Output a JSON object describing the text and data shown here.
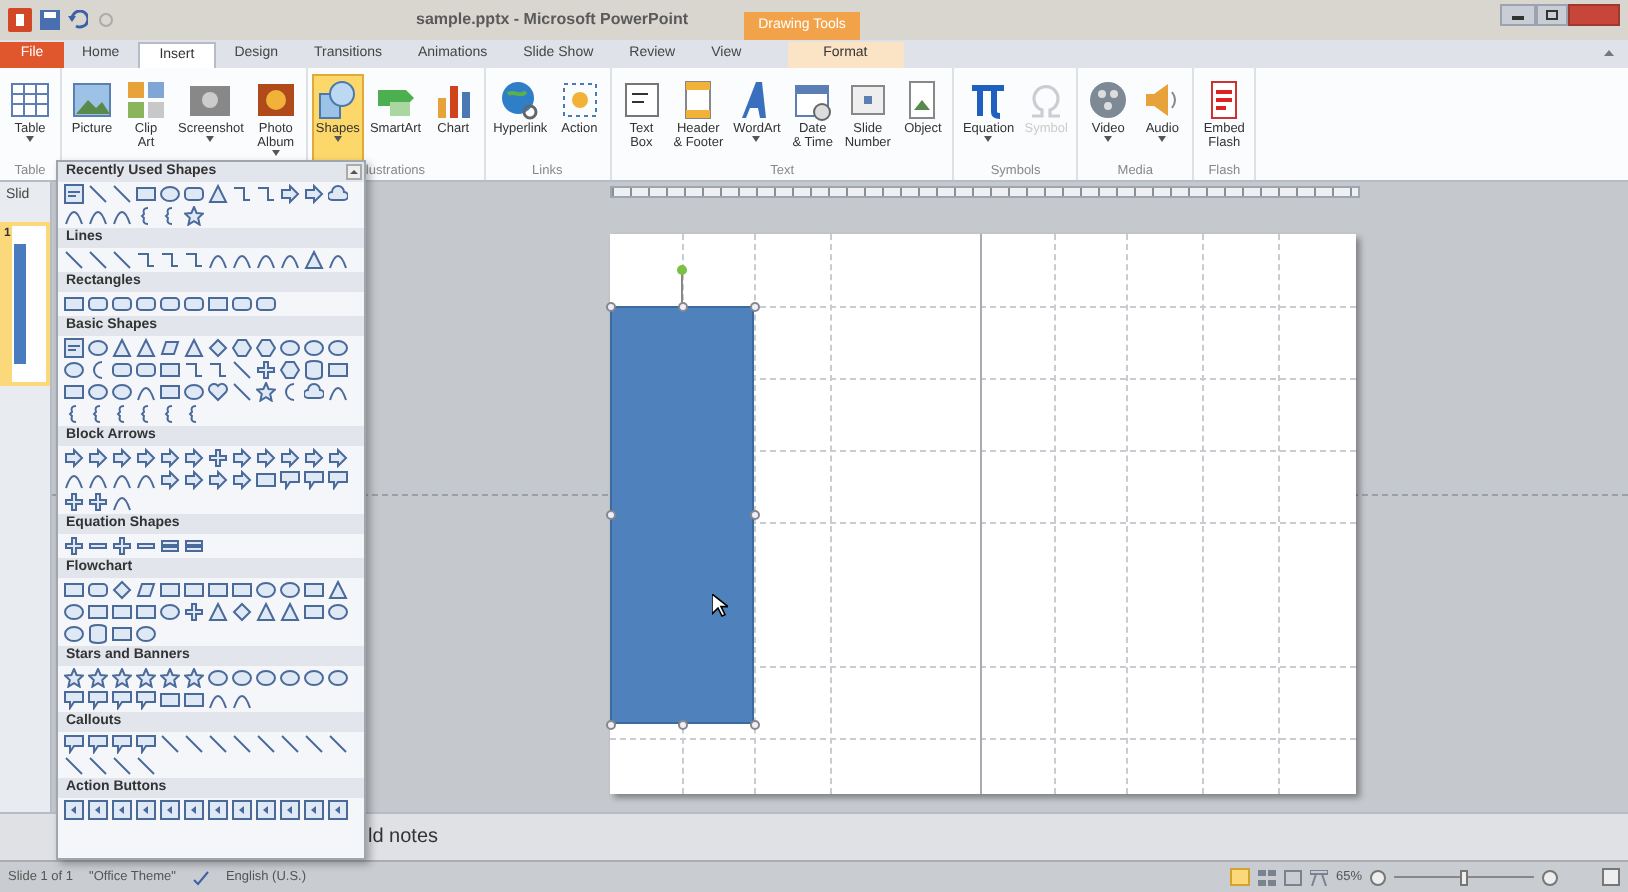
{
  "window": {
    "title": "sample.pptx - Microsoft PowerPoint",
    "context_tab": "Drawing Tools"
  },
  "tabs": [
    {
      "label": "File",
      "kind": "file",
      "selected": false
    },
    {
      "label": "Home",
      "kind": "tab",
      "selected": false
    },
    {
      "label": "Insert",
      "kind": "tab",
      "selected": true
    },
    {
      "label": "Design",
      "kind": "tab",
      "selected": false
    },
    {
      "label": "Transitions",
      "kind": "tab",
      "selected": false
    },
    {
      "label": "Animations",
      "kind": "tab",
      "selected": false
    },
    {
      "label": "Slide Show",
      "kind": "tab",
      "selected": false
    },
    {
      "label": "Review",
      "kind": "tab",
      "selected": false
    },
    {
      "label": "View",
      "kind": "tab",
      "selected": false
    },
    {
      "label": "Format",
      "kind": "context",
      "selected": false
    }
  ],
  "ribbon": [
    {
      "label": "Table",
      "buttons": [
        {
          "lines": [
            "Table"
          ],
          "dropdown": true,
          "selected": false,
          "disabled": false
        }
      ]
    },
    {
      "buttons": [
        {
          "lines": [
            "Picture"
          ],
          "dropdown": false,
          "selected": false,
          "disabled": false
        },
        {
          "lines": [
            "Clip",
            "Art"
          ],
          "dropdown": false,
          "selected": false,
          "disabled": false
        },
        {
          "lines": [
            "Screenshot"
          ],
          "dropdown": true,
          "selected": false,
          "disabled": false
        },
        {
          "lines": [
            "Photo",
            "Album"
          ],
          "dropdown": true,
          "selected": false,
          "disabled": false
        }
      ]
    },
    {
      "label": "lustrations",
      "buttons": [
        {
          "lines": [
            "Shapes"
          ],
          "dropdown": true,
          "selected": true,
          "disabled": false
        },
        {
          "lines": [
            "SmartArt"
          ],
          "dropdown": false,
          "selected": false,
          "disabled": false
        },
        {
          "lines": [
            "Chart"
          ],
          "dropdown": false,
          "selected": false,
          "disabled": false
        }
      ]
    },
    {
      "label": "Links",
      "buttons": [
        {
          "lines": [
            "Hyperlink"
          ],
          "dropdown": false,
          "selected": false,
          "disabled": false
        },
        {
          "lines": [
            "Action"
          ],
          "dropdown": false,
          "selected": false,
          "disabled": false
        }
      ]
    },
    {
      "label": "Text",
      "buttons": [
        {
          "lines": [
            "Text",
            "Box"
          ],
          "dropdown": false,
          "selected": false,
          "disabled": false
        },
        {
          "lines": [
            "Header",
            "& Footer"
          ],
          "dropdown": false,
          "selected": false,
          "disabled": false
        },
        {
          "lines": [
            "WordArt"
          ],
          "dropdown": true,
          "selected": false,
          "disabled": false
        },
        {
          "lines": [
            "Date",
            "& Time"
          ],
          "dropdown": false,
          "selected": false,
          "disabled": false
        },
        {
          "lines": [
            "Slide",
            "Number"
          ],
          "dropdown": false,
          "selected": false,
          "disabled": false
        },
        {
          "lines": [
            "Object"
          ],
          "dropdown": false,
          "selected": false,
          "disabled": false
        }
      ]
    },
    {
      "label": "Symbols",
      "buttons": [
        {
          "lines": [
            "Equation"
          ],
          "dropdown": true,
          "selected": false,
          "disabled": false
        },
        {
          "lines": [
            "Symbol"
          ],
          "dropdown": false,
          "selected": false,
          "disabled": true
        }
      ]
    },
    {
      "label": "Media",
      "buttons": [
        {
          "lines": [
            "Video"
          ],
          "dropdown": true,
          "selected": false,
          "disabled": false
        },
        {
          "lines": [
            "Audio"
          ],
          "dropdown": true,
          "selected": false,
          "disabled": false
        }
      ]
    },
    {
      "label": "Flash",
      "buttons": [
        {
          "lines": [
            "Embed",
            "Flash"
          ],
          "dropdown": false,
          "selected": false,
          "disabled": false
        }
      ]
    }
  ],
  "slides_panel": {
    "tab": "Slid",
    "slides": [
      {
        "number": "1",
        "selected": true
      }
    ]
  },
  "shapes_gallery": [
    {
      "title": "Recently Used Shapes"
    },
    {
      "title": "Lines"
    },
    {
      "title": "Rectangles"
    },
    {
      "title": "Basic Shapes"
    },
    {
      "title": "Block Arrows"
    },
    {
      "title": "Equation Shapes"
    },
    {
      "title": "Flowchart"
    },
    {
      "title": "Stars and Banners"
    },
    {
      "title": "Callouts"
    },
    {
      "title": "Action Buttons"
    }
  ],
  "notes": {
    "text": "ld notes"
  },
  "status_bar": {
    "slide": "Slide 1 of 1",
    "theme": "\"Office Theme\"",
    "language": "English (U.S.)",
    "zoom": "65%",
    "zoom_slider": {
      "level": 0.5
    }
  }
}
